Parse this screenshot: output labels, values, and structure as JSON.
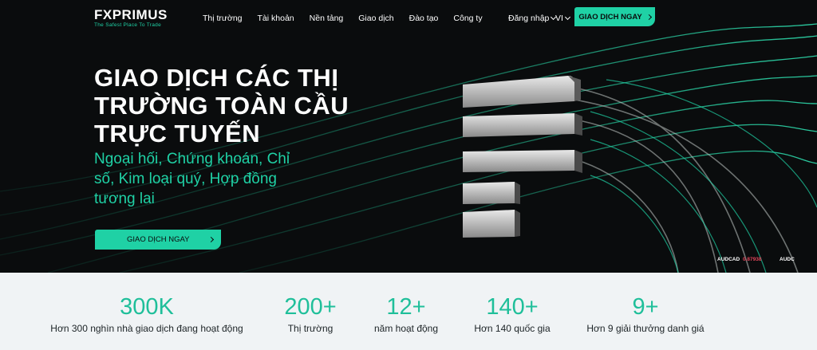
{
  "brand": {
    "logo_text": "FXPRIMUS",
    "tagline": "The Safest Place To Trade"
  },
  "nav": {
    "items": [
      {
        "label": "Thị trường"
      },
      {
        "label": "Tài khoản"
      },
      {
        "label": "Nền tảng"
      },
      {
        "label": "Giao dịch"
      },
      {
        "label": "Đào tạo"
      },
      {
        "label": "Công ty"
      }
    ],
    "login_label": "Đăng nhập",
    "language": "VI",
    "cta_label": "GIAO DỊCH NGAY"
  },
  "hero": {
    "headline": "GIAO DỊCH CÁC THỊ TRƯỜNG TOÀN CẦU TRỰC TUYẾN",
    "subheadline": "Ngoại hối, Chứng khoán, Chỉ số, Kim loại quý, Hợp đồng tương lai",
    "cta_label": "GIAO DỊCH NGAY"
  },
  "ticker": {
    "symbol": "AUDCAD",
    "value": "0.87938",
    "next_symbol": "AUDC"
  },
  "stats": [
    {
      "value": "300K",
      "label": "Hơn 300 nghìn nhà giao dịch đang hoạt động"
    },
    {
      "value": "200+",
      "label": "Thị trường"
    },
    {
      "value": "12+",
      "label": "năm hoạt động"
    },
    {
      "value": "140+",
      "label": "Hơn 140 quốc gia"
    },
    {
      "value": "9+",
      "label": "Hơn 9 giải thưởng danh giá"
    }
  ],
  "colors": {
    "accent": "#1fd1a5",
    "hero_bg": "#0a0c0d",
    "stats_bg": "#f0f3f5",
    "stat_value": "#1fbf9a"
  }
}
